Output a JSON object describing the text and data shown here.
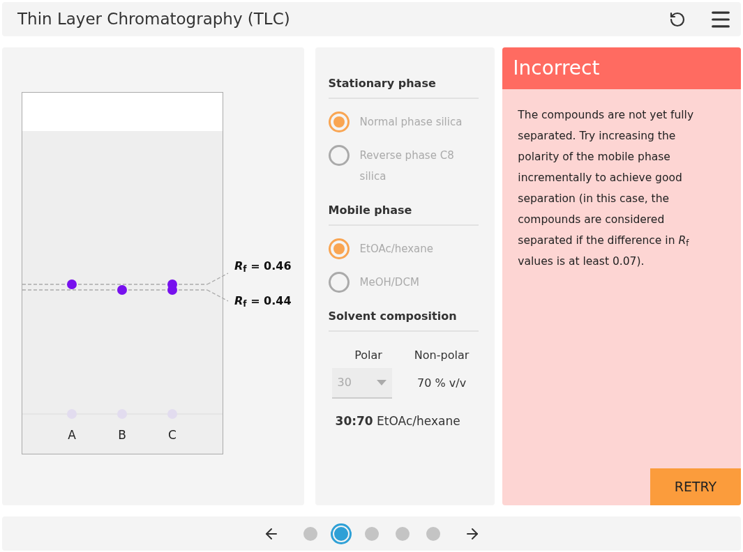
{
  "header": {
    "title": "Thin Layer Chromatography (TLC)"
  },
  "plate": {
    "lanes": [
      {
        "label": "A",
        "upper_spot": true,
        "lower_spot": false
      },
      {
        "label": "B",
        "upper_spot": false,
        "lower_spot": true
      },
      {
        "label": "C",
        "upper_spot": true,
        "lower_spot": true
      }
    ],
    "rf_lines": [
      {
        "kind": "upper",
        "label": "*R*$_{f}$ = 0.46"
      },
      {
        "kind": "lower",
        "label": "*R*$_{f}$ = 0.44"
      }
    ]
  },
  "settings": {
    "sections": [
      {
        "kind": "radio",
        "heading": "Stationary phase",
        "options": [
          {
            "label": "Normal phase silica",
            "selected": true,
            "disabled": true
          },
          {
            "label": "Reverse phase C8 silica",
            "selected": false,
            "disabled": true
          }
        ]
      },
      {
        "kind": "radio",
        "heading": "Mobile phase",
        "options": [
          {
            "label": "EtOAc/hexane",
            "selected": true,
            "disabled": true
          },
          {
            "label": "MeOH/DCM",
            "selected": false,
            "disabled": true
          }
        ]
      },
      {
        "kind": "composition",
        "heading": "Solvent composition",
        "polar_label": "Polar",
        "nonpolar_label": "Non-polar",
        "polar_value": "30",
        "disabled": true,
        "nonpolar_value": "70 % v/v",
        "summary": "**30:70** EtOAc/hexane"
      }
    ]
  },
  "feedback": {
    "title": "Incorrect",
    "message": "The compounds are not yet fully separated. Try increasing the polarity of the mobile phase incrementally to achieve good separation (in this case, the compounds are considered separated if the difference in *R*$_{f}$ values is at least 0.07).",
    "button": "RETRY"
  },
  "pager": {
    "pages": [
      {
        "selected": false
      },
      {
        "selected": true
      },
      {
        "selected": false
      },
      {
        "selected": false
      },
      {
        "selected": false
      }
    ]
  }
}
